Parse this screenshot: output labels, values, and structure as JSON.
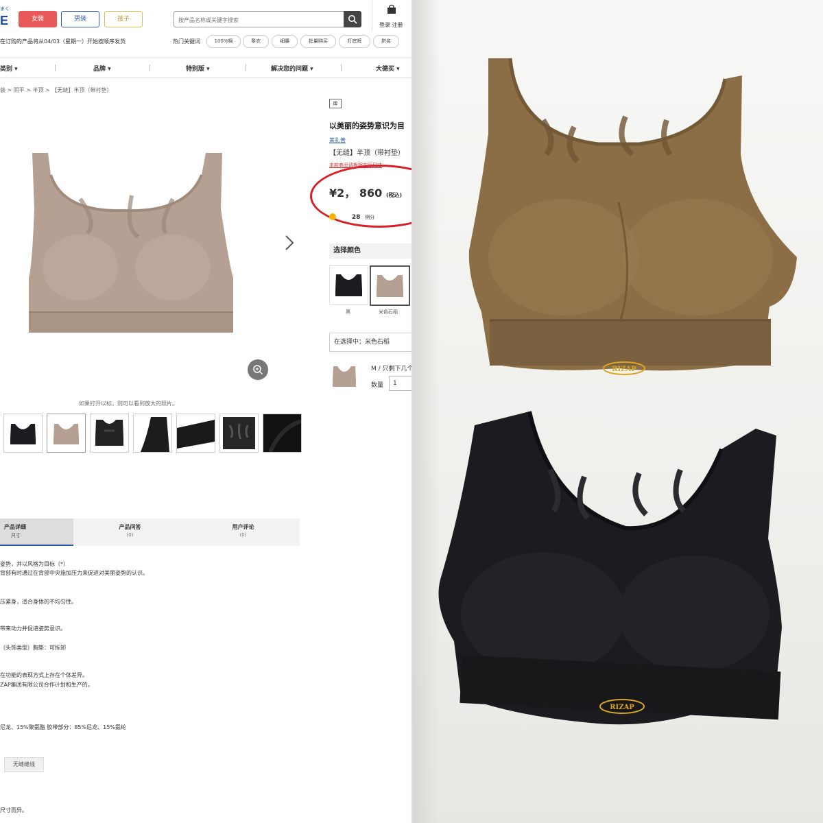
{
  "header": {
    "logo_small": "まく",
    "logo": "E",
    "gender_buttons": [
      "女装",
      "男装",
      "孩子"
    ],
    "notice": "在订购的产品将从04/03（星期一）开始按顺序发货",
    "search_placeholder": "按产品名称或关键字搜索",
    "hot_keywords_label": "热门关键词",
    "hot_keywords": [
      "100%棉",
      "睾衣",
      "细腰",
      "批量购买",
      "打底裤",
      "拼名"
    ],
    "login": "登录 注册"
  },
  "nav": [
    "类别 ▾",
    "品牌 ▾",
    "特别版 ▾",
    "解决您的问题 ▾",
    "大德买 ▾"
  ],
  "breadcrumb": "装 > 阴平 > 半顶 > 【无缝】半顶（带衬垫）",
  "gallery": {
    "hint": "如果打开以标，则可以看到放大的照片。"
  },
  "product": {
    "badge": "库",
    "title": "以美丽的姿势意识为目",
    "brand": "莱扎普",
    "name": "【无缝】半顶（带衬垫）",
    "note": "本款商品请根据实际尺寸",
    "price": "¥2， 860",
    "price_tax": "(税込)",
    "points": "28",
    "points_label": "例分",
    "color_label": "选择颜色",
    "colors": [
      "黑",
      "米色石稻"
    ],
    "selected": "在选择中：米色石稻",
    "size": "M / 只剩下几个",
    "qty_label": "数量",
    "qty": "1"
  },
  "tabs": [
    {
      "label": "产品详细",
      "sub": "尺寸"
    },
    {
      "label": "产品问答",
      "sub": "(0)"
    },
    {
      "label": "用户评论",
      "sub": "(0)"
    }
  ],
  "description": [
    "姿势，并以风格为目标（*）",
    "背部有时通过在背部中央施加压力来促进对美丽姿势的认识。",
    "压紧身，适合身体的不均匀性。",
    "带来动力并促进姿势意识。",
    "（头饰类型）胸垫：可拆卸",
    "在功能的表现方式上存在个体差异。",
    "ZAP集团有限公司合作计划和生产的。",
    "尼龙、15%聚氨酯 胶带部分：85%尼龙、15%氨纶",
    "尺寸而异。"
  ],
  "tag": "无缝缝线",
  "photo": {
    "brand_mark": "RIZAP"
  },
  "colors": {
    "accent_red": "#e85a5a",
    "link_blue": "#2b5aa8",
    "highlight_circle": "#d81f26",
    "beige_product": "#b5a093",
    "brown_product": "#8b6e45",
    "black_product": "#1c1c20",
    "logo_gold": "#d8a624"
  }
}
